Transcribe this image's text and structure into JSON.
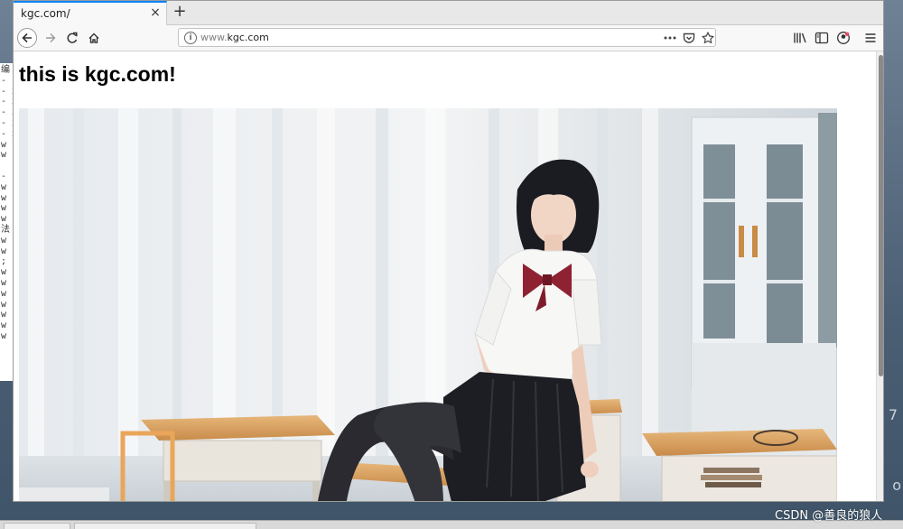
{
  "browser": {
    "tab_title": "kgc.com/",
    "tab_close": "×",
    "new_tab": "+",
    "url_prefix": "www.",
    "url_domain": "kgc.com"
  },
  "page": {
    "heading": "this is kgc.com!"
  },
  "watermark": "CSDN @善良的狼人",
  "desktop": {
    "terminal_lines": [
      "编",
      "- -",
      "- x",
      "- x",
      "- x",
      "- x",
      "- x",
      "w |",
      "w |",
      "",
      "- -",
      "w |",
      "w |",
      "w |",
      "w |",
      "法",
      "w |",
      "w |",
      "; |",
      "w |",
      "w |",
      "w |",
      "w |",
      "w |",
      "w |",
      "w |"
    ],
    "right_char_1": "7",
    "right_char_2": "o"
  },
  "icons": {
    "back": "back-arrow-icon",
    "forward": "forward-arrow-icon",
    "reload": "reload-icon",
    "home": "home-icon",
    "info": "info-icon",
    "page_actions": "more-dots-icon",
    "pocket": "pocket-icon",
    "bookmark": "star-icon",
    "library": "library-icon",
    "sidebar": "sidebar-icon",
    "account": "account-icon",
    "menu": "hamburger-menu-icon"
  }
}
